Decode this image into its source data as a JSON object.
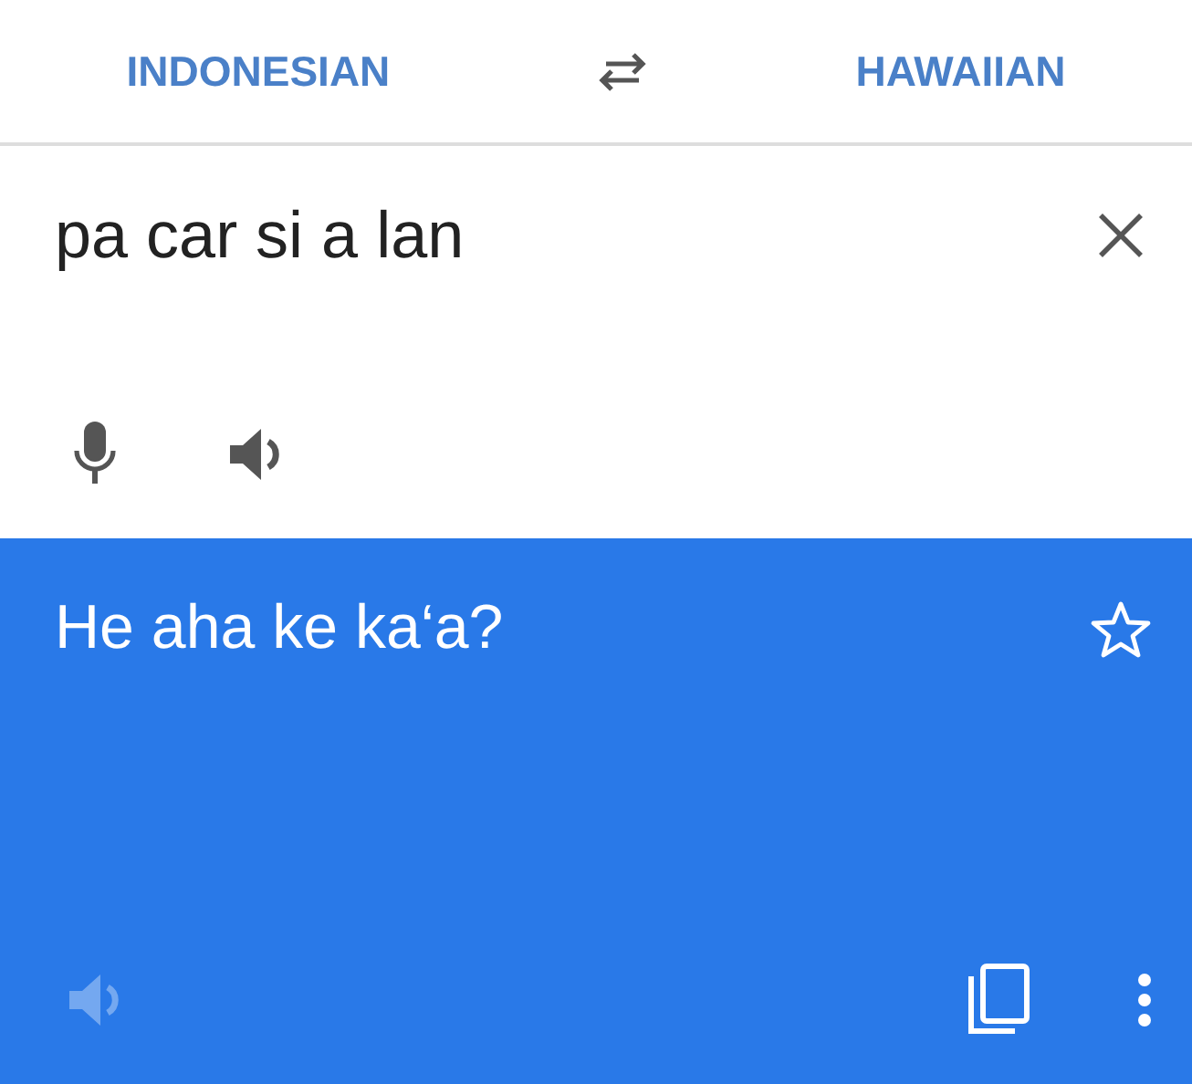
{
  "languages": {
    "source": "INDONESIAN",
    "target": "HAWAIIAN"
  },
  "input": {
    "value": "pa car si a lan"
  },
  "translation": {
    "text": "He aha ke ka‘a?",
    "starred": false,
    "speaker_disabled": true
  }
}
